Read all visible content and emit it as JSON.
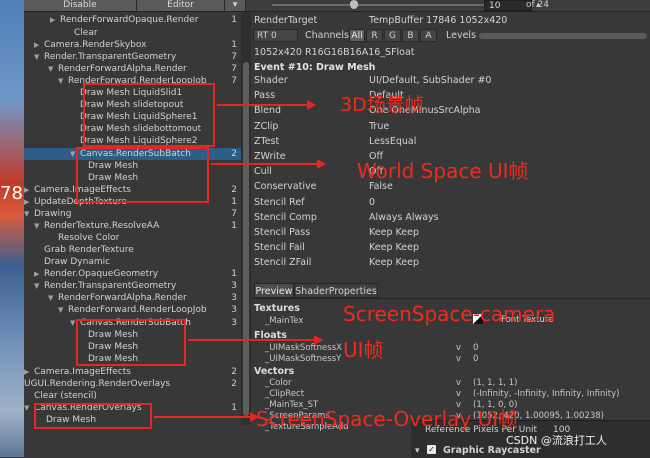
{
  "toolbar": {
    "disable_label": "Disable",
    "editor_label": "Editor",
    "event_index": "10",
    "of_label": "of 24"
  },
  "tree": {
    "rows": [
      {
        "label": "RenderForwardOpaque.Render",
        "count": "1"
      },
      {
        "label": "Clear",
        "count": ""
      },
      {
        "label": "Camera.RenderSkybox",
        "count": "1"
      },
      {
        "label": "Render.TransparentGeometry",
        "count": "7"
      },
      {
        "label": "RenderForwardAlpha.Render",
        "count": "7"
      },
      {
        "label": "RenderForward.RenderLoopJob",
        "count": "7"
      },
      {
        "label": "Draw Mesh LiquidSlid1",
        "count": ""
      },
      {
        "label": "Draw Mesh slidetopout",
        "count": ""
      },
      {
        "label": "Draw Mesh LiquidSphere1",
        "count": ""
      },
      {
        "label": "Draw Mesh slidebottomout",
        "count": ""
      },
      {
        "label": "Draw Mesh LiquidSphere2",
        "count": ""
      },
      {
        "label": "Canvas.RenderSubBatch",
        "count": "2"
      },
      {
        "label": "Draw Mesh",
        "count": ""
      },
      {
        "label": "Draw Mesh",
        "count": ""
      },
      {
        "label": "Camera.ImageEffects",
        "count": "2"
      },
      {
        "label": "UpdateDepthTexture",
        "count": "1"
      },
      {
        "label": "Drawing",
        "count": "7"
      },
      {
        "label": "RenderTexture.ResolveAA",
        "count": "1"
      },
      {
        "label": "Resolve Color",
        "count": ""
      },
      {
        "label": "Grab RenderTexture",
        "count": ""
      },
      {
        "label": "Draw Dynamic",
        "count": ""
      },
      {
        "label": "Render.OpaqueGeometry",
        "count": "1"
      },
      {
        "label": "Render.TransparentGeometry",
        "count": "3"
      },
      {
        "label": "RenderForwardAlpha.Render",
        "count": "3"
      },
      {
        "label": "RenderForward.RenderLoopJob",
        "count": "3"
      },
      {
        "label": "Canvas.RenderSubBatch",
        "count": "3"
      },
      {
        "label": "Draw Mesh",
        "count": ""
      },
      {
        "label": "Draw Mesh",
        "count": ""
      },
      {
        "label": "Draw Mesh",
        "count": ""
      },
      {
        "label": "Camera.ImageEffects",
        "count": "2"
      },
      {
        "label": "UGUI.Rendering.RenderOverlays",
        "count": "2"
      },
      {
        "label": "Clear (stencil)",
        "count": ""
      },
      {
        "label": "Canvas.RenderOverlays",
        "count": "1"
      },
      {
        "label": "Draw Mesh",
        "count": ""
      }
    ]
  },
  "detail": {
    "render_target_label": "RenderTarget",
    "render_target_value": "TempBuffer 17846 1052x420",
    "rt_select": "RT 0",
    "channels_label": "Channels",
    "channels": [
      "All",
      "R",
      "G",
      "B",
      "A"
    ],
    "levels_label": "Levels",
    "format_line": "1052x420 R16G16B16A16_SFloat",
    "event_title": "Event #10: Draw Mesh",
    "properties": [
      {
        "key": "Shader",
        "value": "UI/Default, SubShader #0"
      },
      {
        "key": "Pass",
        "value": "Default"
      },
      {
        "key": "Blend",
        "value": "One OneMinusSrcAlpha"
      },
      {
        "key": "ZClip",
        "value": "True"
      },
      {
        "key": "ZTest",
        "value": "LessEqual"
      },
      {
        "key": "ZWrite",
        "value": "Off"
      },
      {
        "key": "Cull",
        "value": "Off"
      },
      {
        "key": "Conservative",
        "value": "False"
      },
      {
        "key": "Stencil Ref",
        "value": "0"
      },
      {
        "key": "Stencil Comp",
        "value": "Always Always"
      },
      {
        "key": "Stencil Pass",
        "value": "Keep Keep"
      },
      {
        "key": "Stencil Fail",
        "value": "Keep Keep"
      },
      {
        "key": "Stencil ZFail",
        "value": "Keep Keep"
      }
    ],
    "tabs": [
      "Preview",
      "ShaderProperties"
    ],
    "textures_header": "Textures",
    "main_tex_key": "_MainTex",
    "main_tex_value": "Font Texture",
    "floats_header": "Floats",
    "floats": [
      {
        "key": "_UIMaskSoftnessX",
        "flag": "v",
        "value": "0"
      },
      {
        "key": "_UIMaskSoftnessY",
        "flag": "v",
        "value": "0"
      }
    ],
    "vectors_header": "Vectors",
    "vectors": [
      {
        "key": "_Color",
        "flag": "v",
        "value": "(1, 1, 1, 1)"
      },
      {
        "key": "_ClipRect",
        "flag": "v",
        "value": "(-Infinity, -Infinity, Infinity, Infinity)"
      },
      {
        "key": "_MainTex_ST",
        "flag": "v",
        "value": "(1, 1, 0, 0)"
      },
      {
        "key": "_ScreenParams",
        "flag": "v",
        "value": "(1052, 420, 1.00095, 1.00238)"
      },
      {
        "key": "_TextureSampleAdd",
        "flag": "",
        "value": ""
      }
    ]
  },
  "inspector": {
    "ref_label": "Reference Pixels Per Unit",
    "ref_value": "100",
    "component_label": "Graphic Raycaster"
  },
  "annotations": {
    "a1": "3D场景帧",
    "a2": "World Space UI帧",
    "a3_line1": "ScreenSpace-camera",
    "a3_line2": "UI帧",
    "a4": "ScreenSpace-Overlay UI帧"
  },
  "scene": {
    "visible_number": "78"
  },
  "watermark": "CSDN @流浪打工人",
  "colors": {
    "annotation": "#e8251e",
    "selection": "#2c5d87"
  }
}
